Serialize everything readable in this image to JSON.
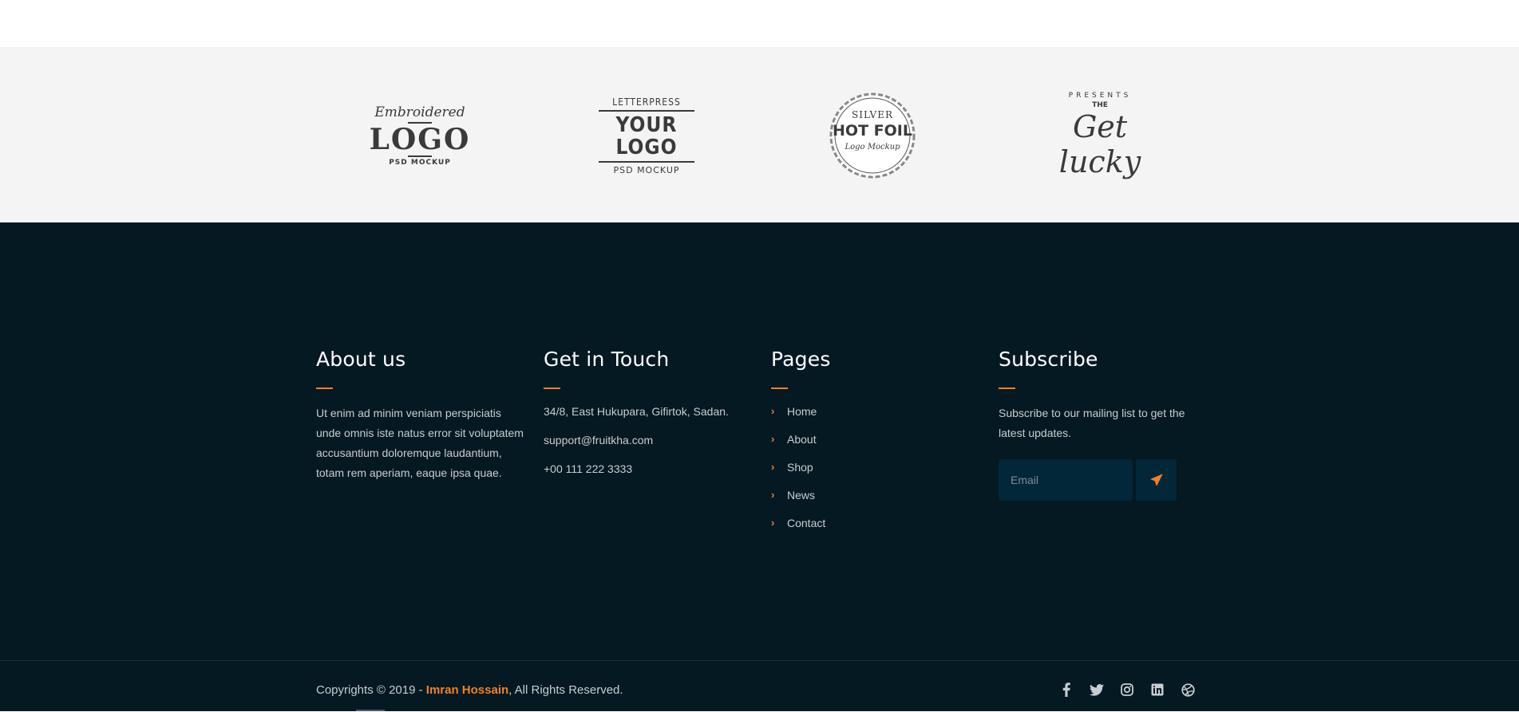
{
  "logos": [
    {
      "name": "embroidered-logo",
      "line1": "Embroidered",
      "line2": "LOGO",
      "line3": "PSD MOCKUP"
    },
    {
      "name": "letterpress-logo",
      "line1": "LETTERPRESS",
      "line2": "YOUR LOGO",
      "line3": "PSD MOCKUP"
    },
    {
      "name": "silver-hot-foil-logo",
      "line1": "SILVER",
      "line2": "HOT FOIL",
      "line3": "Logo Mockup"
    },
    {
      "name": "get-lucky-logo",
      "line1": "PRESENTS",
      "line2": "THE",
      "line3": "Get lucky"
    }
  ],
  "footer": {
    "about": {
      "title": "About us",
      "text": "Ut enim ad minim veniam perspiciatis unde omnis iste natus error sit voluptatem accusantium doloremque laudantium, totam rem aperiam, eaque ipsa quae."
    },
    "contact": {
      "title": "Get in Touch",
      "address": "34/8, East Hukupara, Gifirtok, Sadan.",
      "email": "support@fruitkha.com",
      "phone": "+00 111 222 3333"
    },
    "pages": {
      "title": "Pages",
      "links": [
        "Home",
        "About",
        "Shop",
        "News",
        "Contact"
      ]
    },
    "subscribe": {
      "title": "Subscribe",
      "text": "Subscribe to our mailing list to get the latest updates.",
      "email_placeholder": "Email"
    }
  },
  "bottom": {
    "copyright_prefix": "Copyrights © 2019 - ",
    "author": "Imran Hossain",
    "copyright_suffix": ", All Rights Reserved.",
    "social_icons": [
      "facebook-icon",
      "twitter-icon",
      "instagram-icon",
      "linkedin-icon",
      "dribbble-icon"
    ]
  },
  "colors": {
    "accent": "#F28123",
    "footer_bg": "#051922",
    "input_bg": "#012738",
    "logo_strip_bg": "#f4f4f4"
  }
}
